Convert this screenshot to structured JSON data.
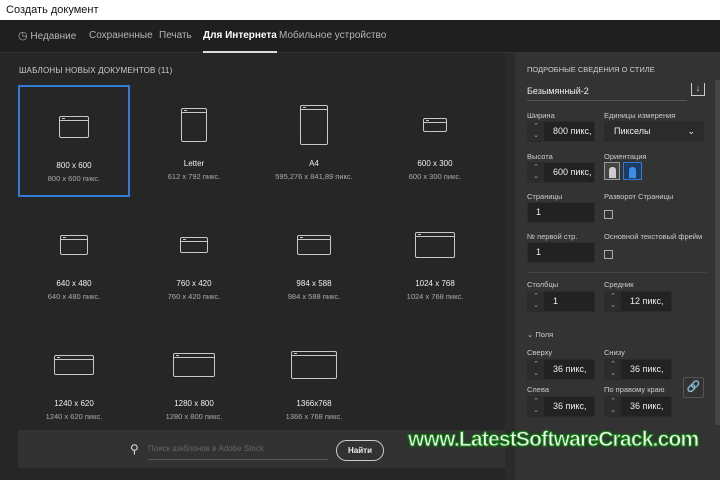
{
  "window": {
    "title": "Создать документ"
  },
  "tabs": [
    {
      "label": "Недавние",
      "icon": "clock-icon"
    },
    {
      "label": "Сохраненные"
    },
    {
      "label": "Печать"
    },
    {
      "label": "Для Интернета",
      "active": true
    },
    {
      "label": "Мобильное устройство"
    }
  ],
  "templates": {
    "heading": "ШАБЛОНЫ НОВЫХ ДОКУМЕНТОВ  (11)",
    "items": [
      {
        "name": "800 x 600",
        "size": "800 x 600 пикс.",
        "selected": true
      },
      {
        "name": "Letter",
        "size": "612 x 792 пикс."
      },
      {
        "name": "A4",
        "size": "595,276 x 841,89 пикс."
      },
      {
        "name": "600 x 300",
        "size": "600 x 300 пикс."
      },
      {
        "name": "640 x 480",
        "size": "640 x 480 пикс."
      },
      {
        "name": "760 x 420",
        "size": "760 x 420 пикс."
      },
      {
        "name": "984 x 588",
        "size": "984 x 588 пикс."
      },
      {
        "name": "1024 x 768",
        "size": "1024 x 768 пикс."
      },
      {
        "name": "1240 x 620",
        "size": "1240 x 620 пикс."
      },
      {
        "name": "1280 x 800",
        "size": "1280 x 800 пикс."
      },
      {
        "name": "1366x768",
        "size": "1366 x 768 пикс."
      }
    ]
  },
  "search": {
    "placeholder": "Поиск шаблонов в Adobe Stock",
    "button": "Найти"
  },
  "details": {
    "heading": "ПОДРОБНЫЕ СВЕДЕНИЯ О СТИЛЕ",
    "doc_name": "Безымянный-2",
    "width_label": "Ширина",
    "width": "800 пикс,",
    "units_label": "Единицы измерения",
    "units": "Пикселы",
    "height_label": "Высота",
    "height": "600 пикс,",
    "orientation_label": "Ориентация",
    "pages_label": "Страницы",
    "pages": "1",
    "spread_label": "Разворот Страницы",
    "first_page_label": "№ первой стр.",
    "first_page": "1",
    "text_frame_label": "Основной текстовый фрейм",
    "columns_label": "Столбцы",
    "columns": "1",
    "gutter_label": "Средник",
    "gutter": "12 пикс,",
    "margins_label": "Поля",
    "top_label": "Сверху",
    "top": "36 пикс,",
    "bottom_label": "Снизу",
    "bottom": "36 пикс,",
    "left_label": "Слева",
    "left": "36 пикс,",
    "right_label": "По правому краю",
    "right": "36 пикс,"
  },
  "colors": {
    "accent": "#2f7bd6"
  },
  "watermark": "www.LatestSoftwareCrack.com"
}
